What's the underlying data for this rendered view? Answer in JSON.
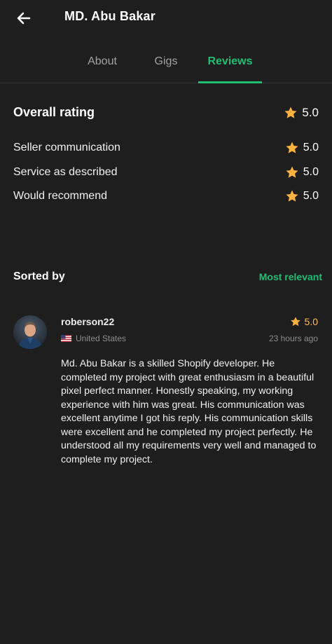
{
  "header": {
    "back_icon": "arrow-left-icon",
    "title": "MD. Abu Bakar"
  },
  "tabs": [
    {
      "label": "About",
      "active": false
    },
    {
      "label": "Gigs",
      "active": false
    },
    {
      "label": "Reviews",
      "active": true
    }
  ],
  "ratings": {
    "overall": {
      "label": "Overall rating",
      "value": "5.0"
    },
    "items": [
      {
        "label": "Seller communication",
        "value": "5.0"
      },
      {
        "label": "Service as described",
        "value": "5.0"
      },
      {
        "label": "Would recommend",
        "value": "5.0"
      }
    ],
    "star_icon": "star-icon",
    "star_color": "#ffb33e"
  },
  "sort": {
    "label": "Sorted by",
    "value": "Most relevant"
  },
  "reviews": [
    {
      "username": "roberson22",
      "rating": "5.0",
      "country": "United States",
      "flag_icon": "us-flag-icon",
      "time": "23 hours ago",
      "text": "Md. Abu Bakar is a skilled Shopify developer. He completed my project with great enthusiasm in a beautiful pixel perfect manner. Honestly speaking, my working experience with him was great. His communication was excellent anytime I got his reply. His communication skills were excellent and he completed my project perfectly. He understood all my requirements very well and managed to complete my project."
    }
  ],
  "colors": {
    "background": "#1e1e1f",
    "accent": "#1dbf73",
    "star": "#ffb33e",
    "muted_text": "#8e8e91"
  }
}
